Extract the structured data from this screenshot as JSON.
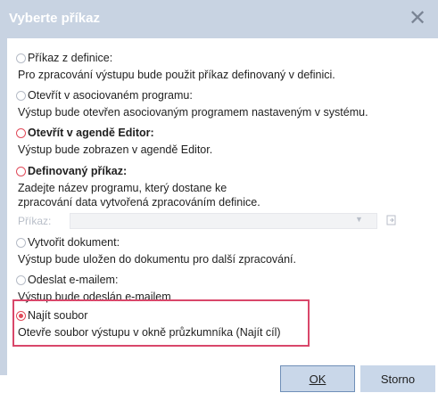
{
  "dialog": {
    "title": "Vyberte příkaz",
    "close_glyph": "✕"
  },
  "options": [
    {
      "label": "Příkaz z definice:",
      "description": "Pro zpracování výstupu bude použit příkaz definovaný v definici.",
      "selected": false
    },
    {
      "label": "Otevřít v asociovaném programu:",
      "description": "Výstup bude otevřen asociovaným programem nastaveným v systému.",
      "selected": false
    },
    {
      "label": "Otevřít v agendě Editor:",
      "description": "Výstup bude zobrazen v agendě Editor.",
      "selected": false
    },
    {
      "label": "Definovaný příkaz:",
      "description_line1": "Zadejte název programu, který dostane ke",
      "description_line2": "zpracování data vytvořená zpracováním definice.",
      "selected": false
    },
    {
      "label": "Vytvořit dokument:",
      "description": "Výstup bude uložen do dokumentu pro další zpracování.",
      "selected": false
    },
    {
      "label": "Odeslat e-mailem:",
      "description": "Výstup bude odeslán e-mailem",
      "selected": false
    },
    {
      "label": "Najít soubor",
      "description": "Otevře soubor výstupu v okně průzkumníka (Najít cíl)",
      "selected": true
    }
  ],
  "prikaz": {
    "label": "Příkaz:",
    "value": ""
  },
  "buttons": {
    "ok": "OK",
    "cancel": "Storno"
  },
  "colors": {
    "titlebar": "#c8d3e2",
    "accent_red": "#e04b5a",
    "highlight": "#d9476a",
    "button_bg": "#c9d7e9"
  }
}
